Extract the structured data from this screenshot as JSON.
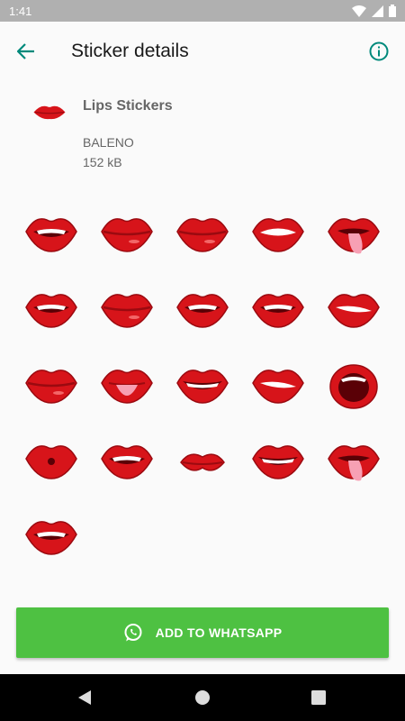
{
  "status_bar": {
    "time": "1:41",
    "icons": [
      "wifi-icon",
      "signal-icon",
      "battery-icon"
    ]
  },
  "app_bar": {
    "title": "Sticker details",
    "back_icon": "arrow-back-icon",
    "info_icon": "info-icon"
  },
  "pack": {
    "name": "Lips Stickers",
    "publisher": "BALENO",
    "size": "152 kB"
  },
  "stickers": [
    "lips-grin",
    "lips-closed",
    "lips-closed",
    "lips-open",
    "lips-tongue-out",
    "lips-grin",
    "lips-closed",
    "lips-grin",
    "lips-grin",
    "lips-bite",
    "lips-closed",
    "lips-tongue",
    "lips-smile",
    "lips-bite",
    "lips-wide-open",
    "lips-pout",
    "lips-grin",
    "lips-kiss",
    "lips-smile",
    "lips-tongue-out",
    "lips-grin"
  ],
  "add_button": {
    "label": "ADD TO WHATSAPP",
    "icon": "whatsapp-icon"
  },
  "nav_bar": {
    "items": [
      "back-triangle-icon",
      "home-circle-icon",
      "recents-square-icon"
    ]
  },
  "colors": {
    "accent": "#00897b",
    "button": "#4ec142",
    "lip_red": "#d7141a",
    "lip_dark": "#9b0a10"
  }
}
